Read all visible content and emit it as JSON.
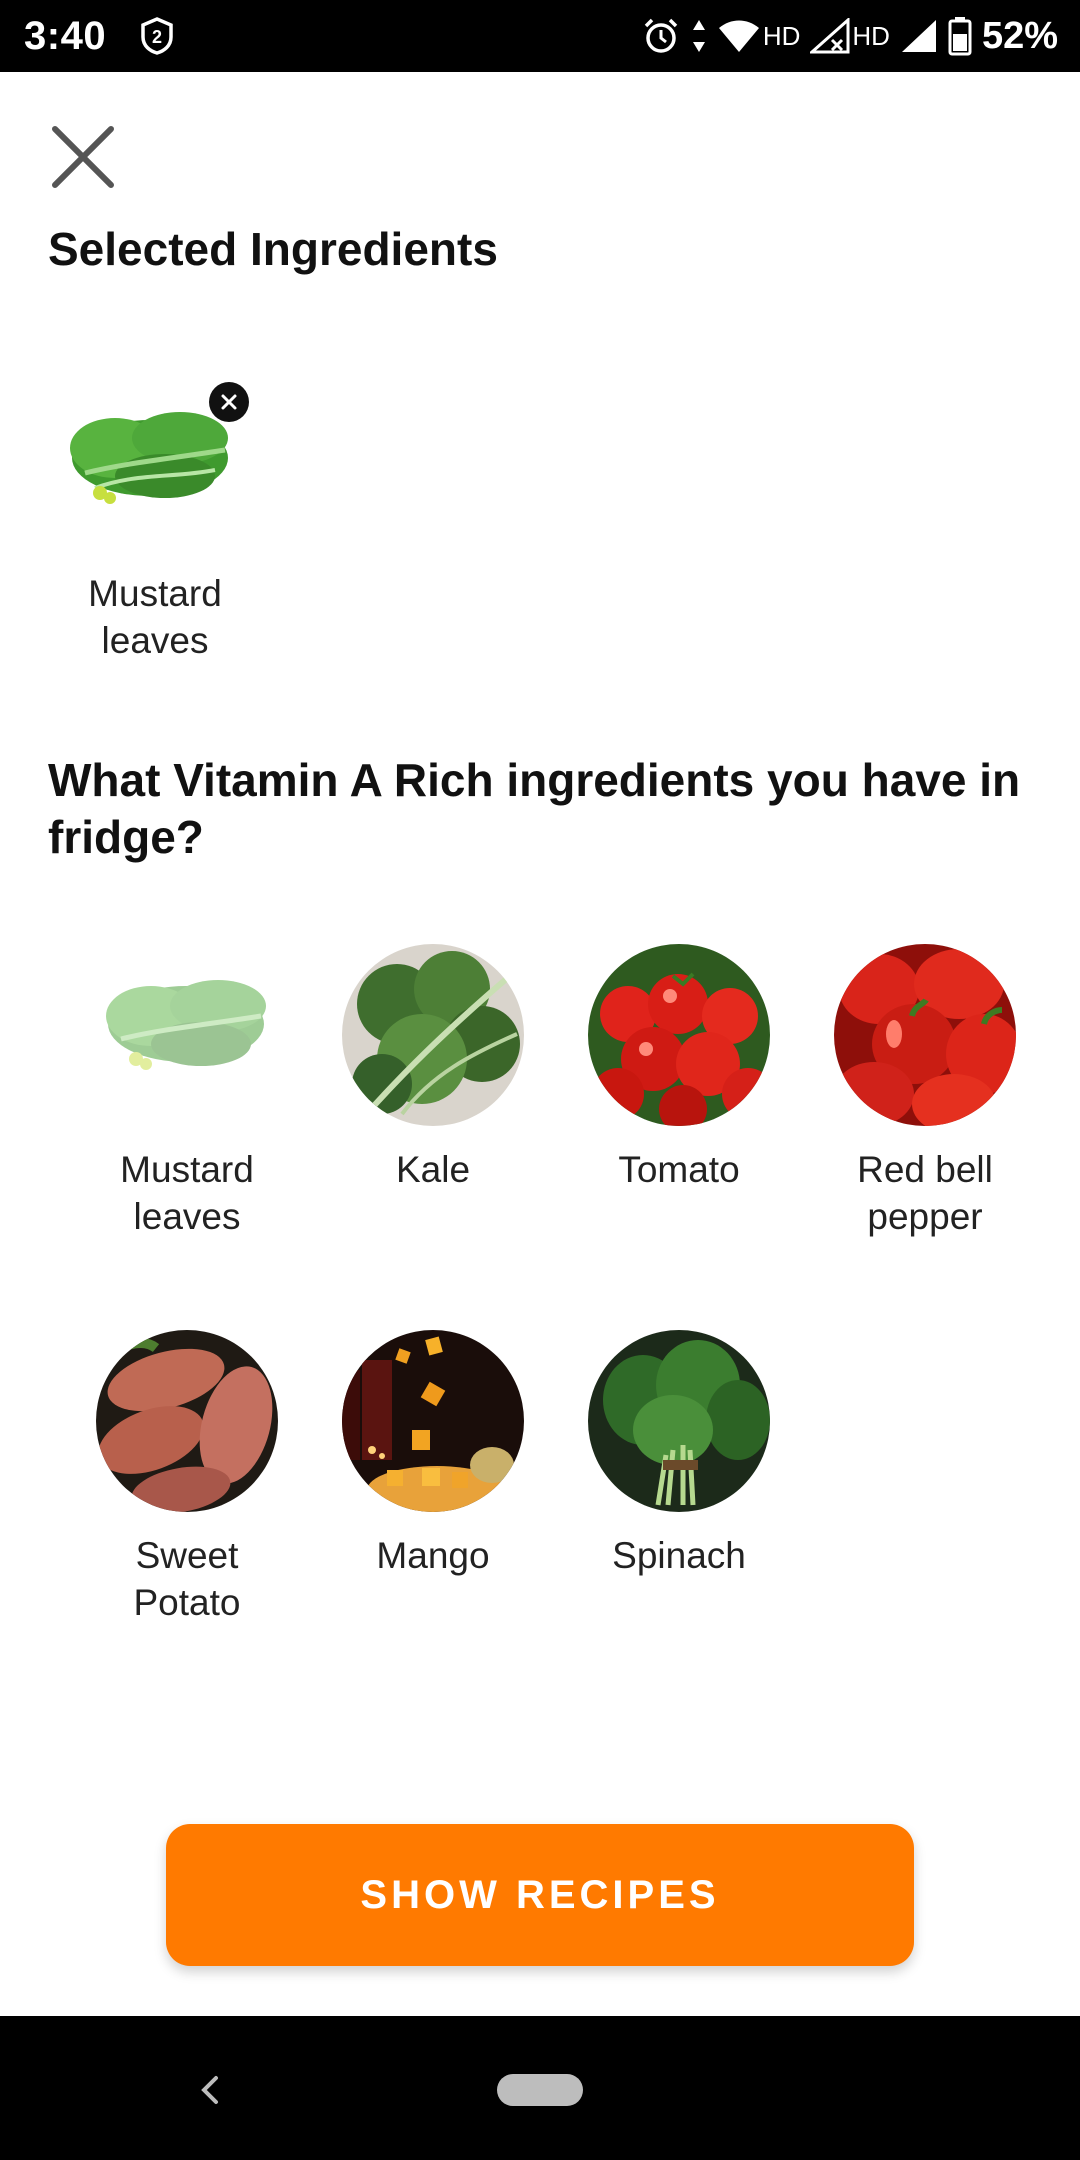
{
  "status_bar": {
    "time": "3:40",
    "notification_count": "2",
    "network_1": "HD",
    "network_2": "HD",
    "battery": "52%"
  },
  "header": {
    "close_icon": "close-icon",
    "selected_title": "Selected Ingredients"
  },
  "selected": [
    {
      "name": "Mustard leaves",
      "icon": "mustard-leaves-image"
    }
  ],
  "question": {
    "title": "What Vitamin A Rich ingredients you have in fridge?"
  },
  "ingredients": [
    {
      "name": "Mustard leaves",
      "icon": "mustard-leaves-image",
      "selected": true
    },
    {
      "name": "Kale",
      "icon": "kale-image",
      "selected": false
    },
    {
      "name": "Tomato",
      "icon": "tomato-image",
      "selected": false
    },
    {
      "name": "Red bell pepper",
      "icon": "red-bell-pepper-image",
      "selected": false
    },
    {
      "name": "Sweet Potato",
      "icon": "sweet-potato-image",
      "selected": false
    },
    {
      "name": "Mango",
      "icon": "mango-image",
      "selected": false
    },
    {
      "name": "Spinach",
      "icon": "spinach-image",
      "selected": false
    }
  ],
  "action": {
    "label": "SHOW RECIPES",
    "color": "#ff7a00"
  },
  "nav": {
    "back_icon": "back-icon",
    "home_icon": "home-pill-icon"
  }
}
